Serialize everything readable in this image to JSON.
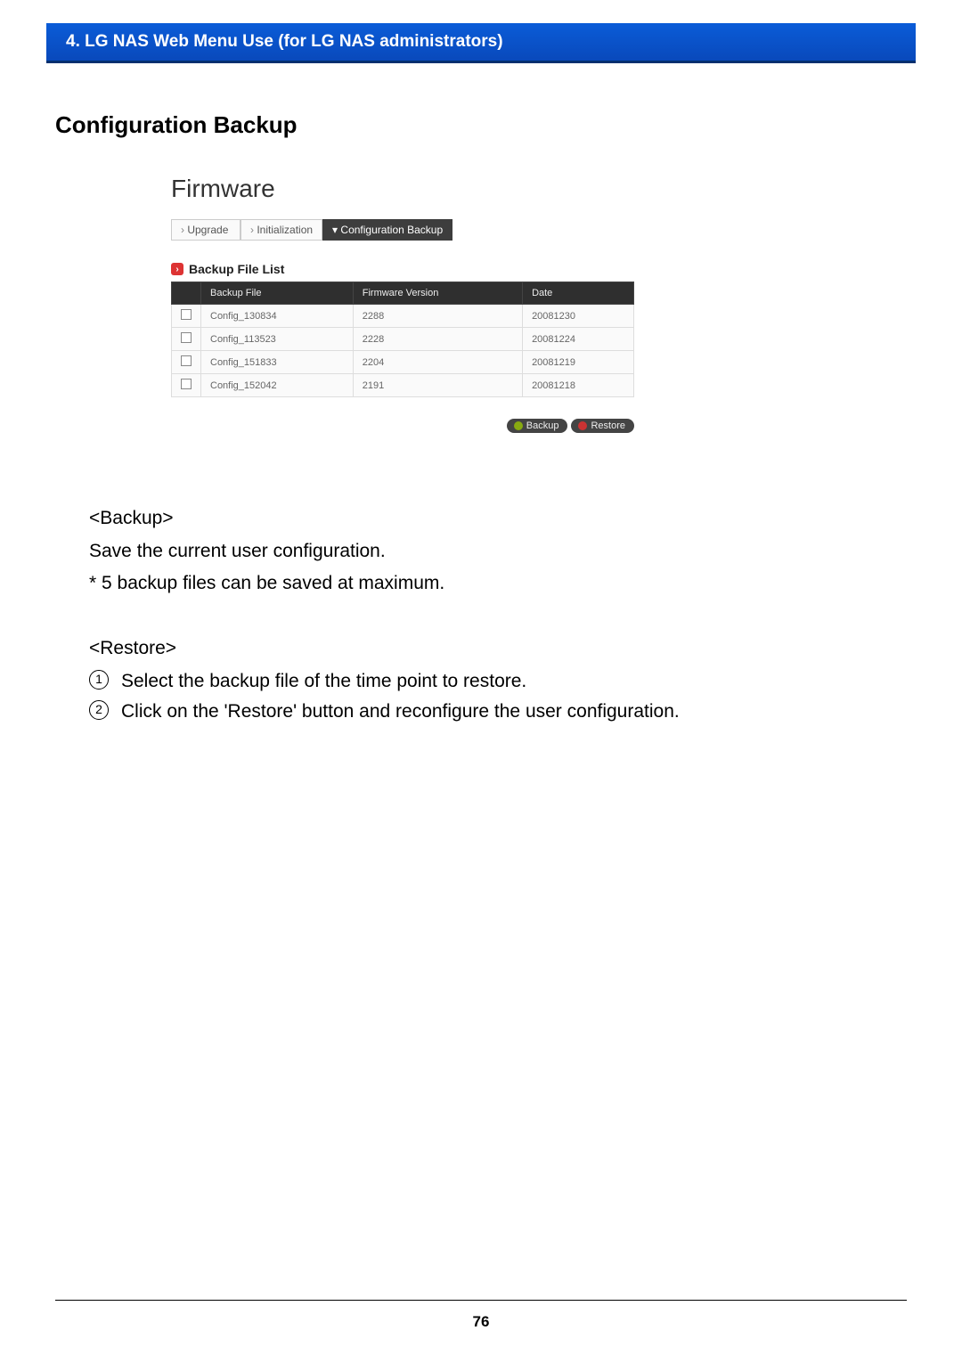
{
  "header": {
    "text": "4. LG NAS Web Menu Use (for LG NAS administrators)"
  },
  "section_title": "Configuration Backup",
  "firmware": {
    "title": "Firmware",
    "tabs": {
      "upgrade": "Upgrade",
      "init": "Initialization",
      "config": "Configuration Backup"
    },
    "list_title": "Backup File List",
    "columns": {
      "file": "Backup File",
      "version": "Firmware Version",
      "date": "Date"
    },
    "rows": [
      {
        "file": "Config_130834",
        "version": "2288",
        "date": "20081230"
      },
      {
        "file": "Config_113523",
        "version": "2228",
        "date": "20081224"
      },
      {
        "file": "Config_151833",
        "version": "2204",
        "date": "20081219"
      },
      {
        "file": "Config_152042",
        "version": "2191",
        "date": "20081218"
      }
    ],
    "buttons": {
      "backup": "Backup",
      "restore": "Restore"
    }
  },
  "doc": {
    "backup_h": "<Backup>",
    "backup_l1": "Save the current user configuration.",
    "backup_l2": "* 5 backup files can be saved at maximum.",
    "restore_h": "<Restore>",
    "restore_s1": "Select the backup file of the time point to restore.",
    "restore_s2": "Click on the 'Restore' button and reconfigure the user configuration."
  },
  "page_number": "76"
}
